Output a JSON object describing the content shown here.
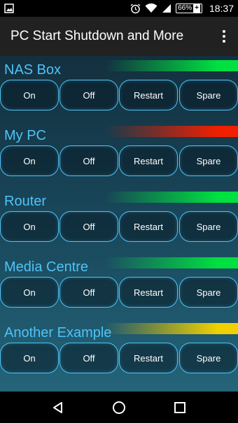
{
  "status_bar": {
    "battery": "66%",
    "time": "18:37"
  },
  "app_bar": {
    "title": "PC Start Shutdown and More"
  },
  "devices": [
    {
      "name": "NAS Box",
      "status_color": "#00e040",
      "buttons": [
        "On",
        "Off",
        "Restart",
        "Spare"
      ]
    },
    {
      "name": "My PC",
      "status_color": "#f02000",
      "buttons": [
        "On",
        "Off",
        "Restart",
        "Spare"
      ]
    },
    {
      "name": "Router",
      "status_color": "#00e040",
      "buttons": [
        "On",
        "Off",
        "Restart",
        "Spare"
      ]
    },
    {
      "name": "Media Centre",
      "status_color": "#00e040",
      "buttons": [
        "On",
        "Off",
        "Restart",
        "Spare"
      ]
    },
    {
      "name": "Another Example",
      "status_color": "#f0d000",
      "buttons": [
        "On",
        "Off",
        "Restart",
        "Spare"
      ]
    }
  ],
  "icons": {
    "status_left": "image-notification-icon",
    "alarm": "alarm-icon",
    "wifi": "wifi-icon",
    "signal": "cell-signal-icon",
    "battery": "battery-charging-icon",
    "overflow": "more-vert-icon",
    "nav_back": "back-icon",
    "nav_home": "home-icon",
    "nav_recents": "recents-icon"
  }
}
